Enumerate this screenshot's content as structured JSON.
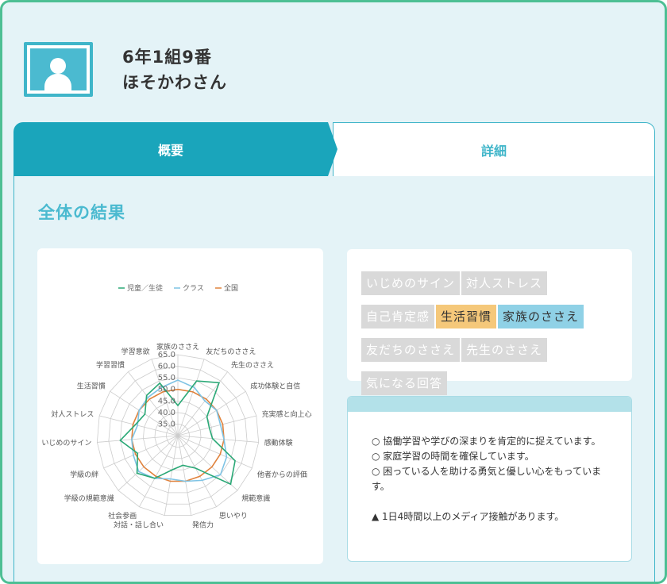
{
  "student": {
    "class_line": "6年1組9番",
    "name_line": "ほそかわさん"
  },
  "tabs": {
    "summary": "概要",
    "detail": "詳細"
  },
  "section": {
    "title": "全体の結果"
  },
  "chart_data": {
    "type": "radar",
    "legend": [
      "児童／生徒",
      "クラス",
      "全国"
    ],
    "colors": {
      "student": "#2aa876",
      "class": "#7ec3e4",
      "national": "#e0823c",
      "grid": "#cccccc"
    },
    "axis_ticks": [
      "35.0",
      "40.0",
      "45.0",
      "50.0",
      "55.0",
      "60.0",
      "65.0"
    ],
    "range": [
      30,
      65
    ],
    "categories": [
      "家族のささえ",
      "友だちのささえ",
      "先生のささえ",
      "成功体験と自信",
      "充実感と向上心",
      "感動体験",
      "他者からの評価",
      "規範意識",
      "思いやり",
      "発信力",
      "対話・話し合い",
      "社会参画",
      "学級の規範意識",
      "学級の絆",
      "いじめのサイン",
      "対人ストレス",
      "生活習慣",
      "学習習慣",
      "学習意欲"
    ],
    "series": [
      {
        "name": "児童／生徒",
        "values": [
          43,
          55,
          59,
          45,
          44,
          45,
          57,
          61,
          46,
          43,
          45,
          51,
          54,
          49,
          55,
          49,
          47,
          52,
          54
        ]
      },
      {
        "name": "クラス",
        "values": [
          54,
          52,
          49,
          50,
          49,
          50,
          53,
          55,
          52,
          50,
          49,
          51,
          53,
          51,
          50,
          48,
          50,
          51,
          52
        ]
      },
      {
        "name": "全国",
        "values": [
          50,
          50,
          50,
          50,
          50,
          50,
          50,
          50,
          50,
          50,
          50,
          50,
          50,
          50,
          50,
          50,
          50,
          50,
          50
        ]
      }
    ]
  },
  "tags": [
    {
      "label": "いじめのサイン",
      "state": "inactive"
    },
    {
      "label": "対人ストレス",
      "state": "inactive"
    },
    {
      "label": "自己肯定感",
      "state": "inactive"
    },
    {
      "label": "生活習慣",
      "state": "orange"
    },
    {
      "label": "家族のささえ",
      "state": "blue"
    },
    {
      "label": "友だちのささえ",
      "state": "inactive"
    },
    {
      "label": "先生のささえ",
      "state": "inactive"
    },
    {
      "label": "気になる回答",
      "state": "inactive"
    }
  ],
  "comments": {
    "good": [
      "○ 協働学習や学びの深まりを肯定的に捉えています。",
      "○ 家庭学習の時間を確保しています。",
      "○ 困っている人を助ける勇気と優しい心をもっています。"
    ],
    "warn": [
      "▲ 1日4時間以上のメディア接触があります。"
    ]
  }
}
